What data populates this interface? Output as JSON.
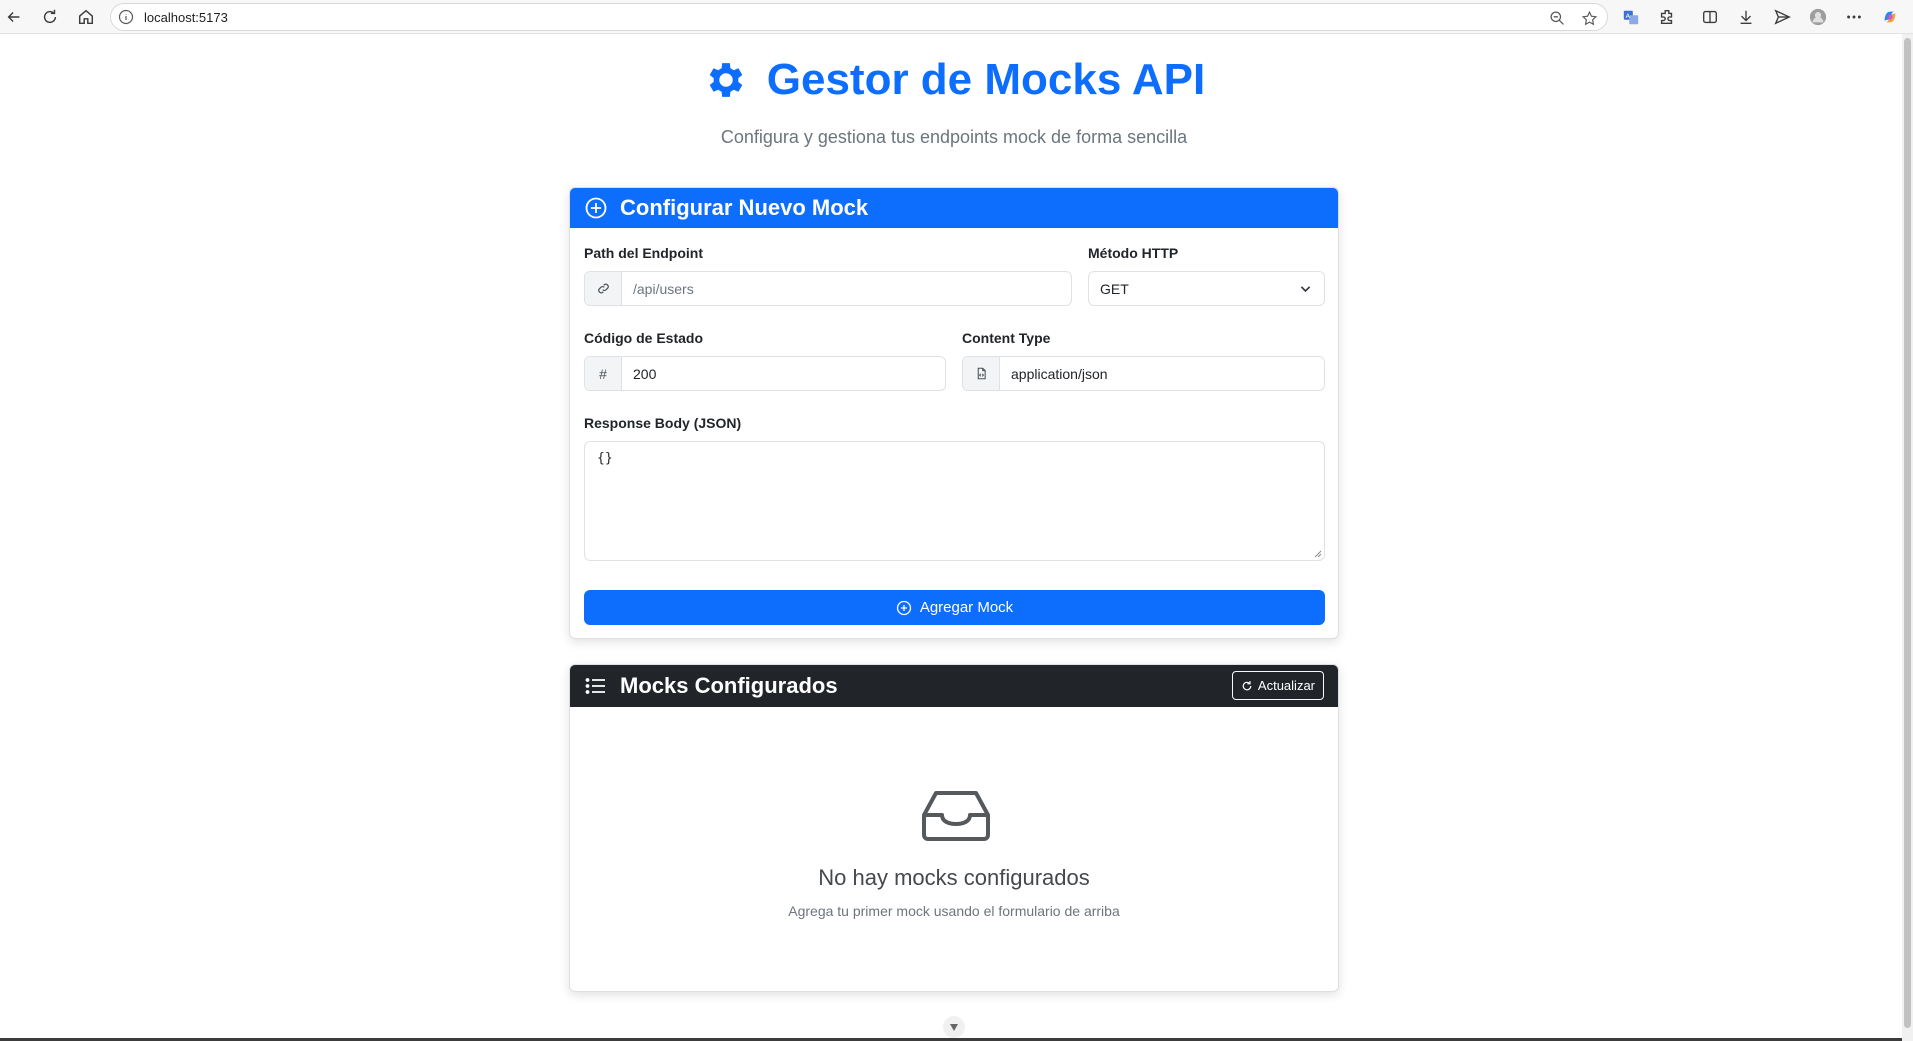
{
  "browser": {
    "url": "localhost:5173"
  },
  "header": {
    "title": "Gestor de Mocks API",
    "subtitle": "Configura y gestiona tus endpoints mock de forma sencilla"
  },
  "form_card": {
    "title": "Configurar Nuevo Mock",
    "path_label": "Path del Endpoint",
    "path_placeholder": "/api/users",
    "method_label": "Método HTTP",
    "method_value": "GET",
    "status_label": "Código de Estado",
    "status_addon": "#",
    "status_value": "200",
    "content_type_label": "Content Type",
    "content_type_value": "application/json",
    "body_label": "Response Body (JSON)",
    "body_value": "{}",
    "submit_label": "Agregar Mock"
  },
  "list_card": {
    "title": "Mocks Configurados",
    "refresh_label": "Actualizar",
    "empty_title": "No hay mocks configurados",
    "empty_text": "Agrega tu primer mock usando el formulario de arriba"
  },
  "colors": {
    "primary": "#0d6efd",
    "dark": "#212529",
    "muted": "#6c757d"
  }
}
